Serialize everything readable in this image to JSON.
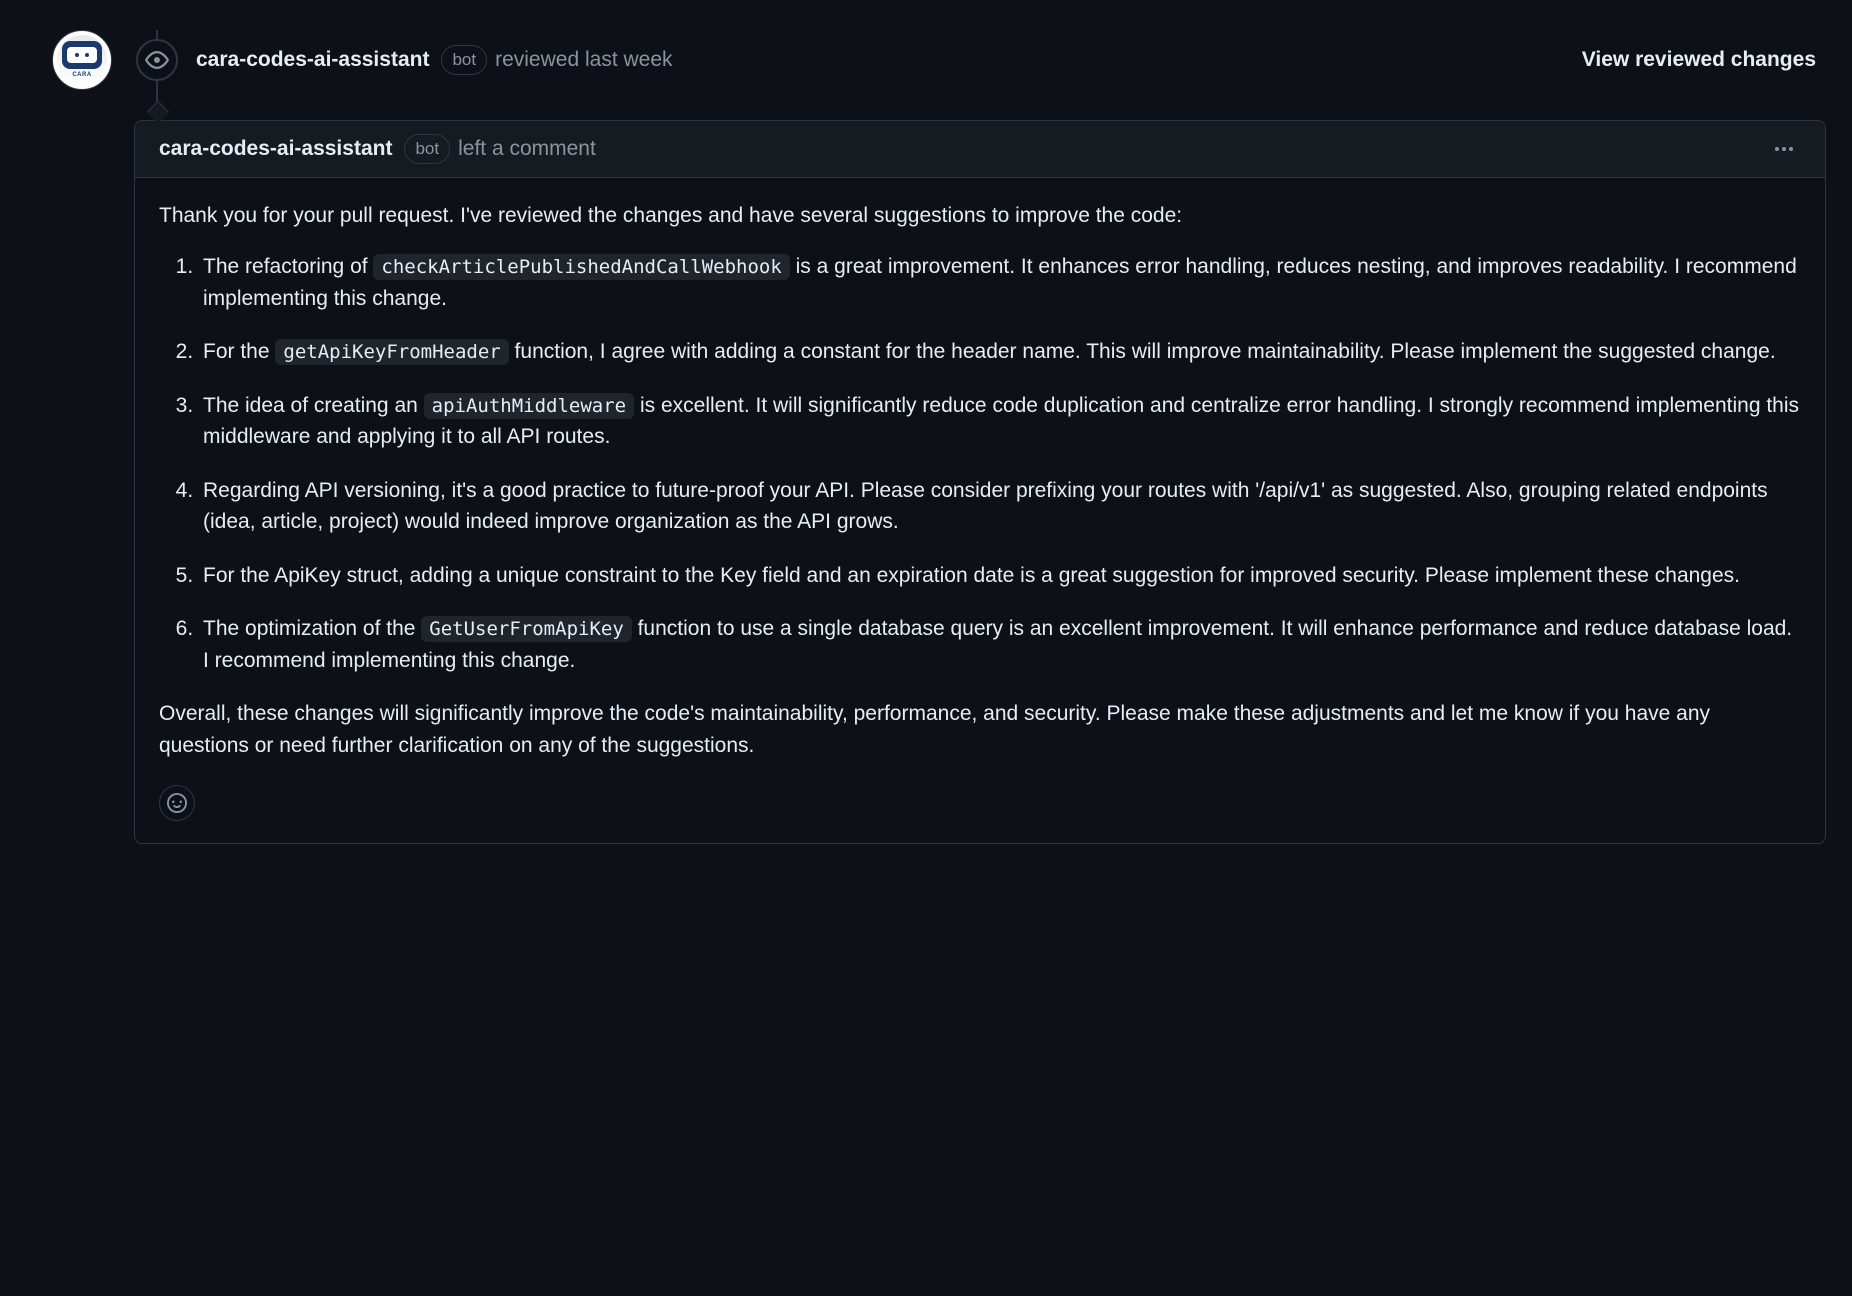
{
  "event": {
    "username": "cara-codes-ai-assistant",
    "bot_label": "bot",
    "action_text": "reviewed last week",
    "view_changes_label": "View reviewed changes"
  },
  "comment": {
    "username": "cara-codes-ai-assistant",
    "bot_label": "bot",
    "suffix": "left a comment",
    "intro": "Thank you for your pull request. I've reviewed the changes and have several suggestions to improve the code:",
    "items": [
      {
        "pre": "The refactoring of ",
        "code": "checkArticlePublishedAndCallWebhook",
        "post": " is a great improvement. It enhances error handling, reduces nesting, and improves readability. I recommend implementing this change."
      },
      {
        "pre": "For the ",
        "code": "getApiKeyFromHeader",
        "post": " function, I agree with adding a constant for the header name. This will improve maintainability. Please implement the suggested change."
      },
      {
        "pre": "The idea of creating an ",
        "code": "apiAuthMiddleware",
        "post": " is excellent. It will significantly reduce code duplication and centralize error handling. I strongly recommend implementing this middleware and applying it to all API routes."
      },
      {
        "pre": "Regarding API versioning, it's a good practice to future-proof your API. Please consider prefixing your routes with '/api/v1' as suggested. Also, grouping related endpoints (idea, article, project) would indeed improve organization as the API grows.",
        "code": "",
        "post": ""
      },
      {
        "pre": "For the ApiKey struct, adding a unique constraint to the Key field and an expiration date is a great suggestion for improved security. Please implement these changes.",
        "code": "",
        "post": ""
      },
      {
        "pre": "The optimization of the ",
        "code": "GetUserFromApiKey",
        "post": " function to use a single database query is an excellent improvement. It will enhance performance and reduce database load. I recommend implementing this change."
      }
    ],
    "outro": "Overall, these changes will significantly improve the code's maintainability, performance, and security. Please make these adjustments and let me know if you have any questions or need further clarification on any of the suggestions."
  },
  "avatar": {
    "label": "CARA"
  }
}
